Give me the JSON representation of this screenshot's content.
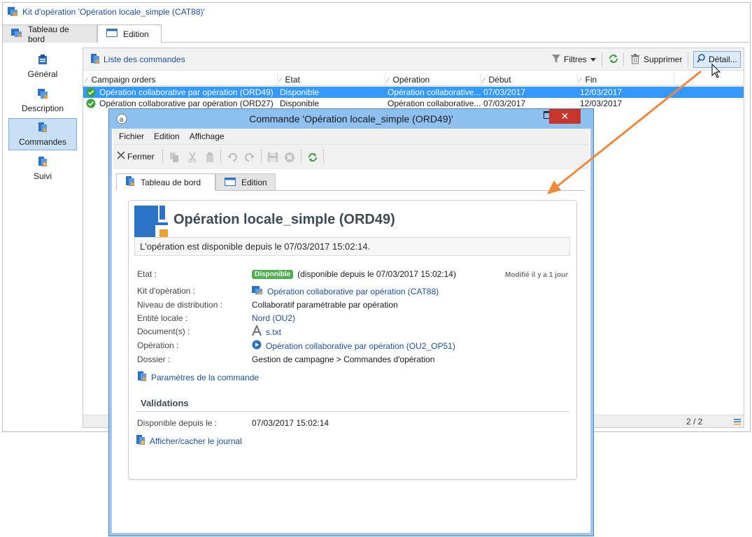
{
  "main": {
    "title": "Kit d'opération 'Opération locale_simple (CAT88)'",
    "tabs": [
      {
        "label": "Tableau de bord"
      },
      {
        "label": "Edition"
      }
    ]
  },
  "nav": {
    "items": [
      {
        "label": "Général"
      },
      {
        "label": "Description"
      },
      {
        "label": "Commandes"
      },
      {
        "label": "Suivi"
      }
    ]
  },
  "list": {
    "title": "Liste des commandes",
    "toolbar": {
      "filters": "Filtres",
      "delete": "Supprimer",
      "detail": "Détail..."
    },
    "columns": [
      "Campaign orders",
      "Etat",
      "Opération",
      "Début",
      "Fin"
    ],
    "rows": [
      {
        "name": "Opération collaborative par opération  (ORD49)",
        "etat": "Disponible",
        "operation": "Opération collaborative...",
        "debut": "07/03/2017",
        "fin": "12/03/2017"
      },
      {
        "name": "Opération collaborative par opération  (ORD27)",
        "etat": "Disponible",
        "operation": "Opération collaborative...",
        "debut": "07/03/2017",
        "fin": "12/03/2017"
      }
    ],
    "pager": "2 / 2"
  },
  "dialog": {
    "title": "Commande 'Opération locale_simple  (ORD49)'",
    "close_glyph": "✕",
    "menu": [
      "Fichier",
      "Edition",
      "Affichage"
    ],
    "close_label": "Fermer",
    "tabs": [
      {
        "label": "Tableau de bord"
      },
      {
        "label": "Edition"
      }
    ],
    "card": {
      "title": "Opération locale_simple (ORD49)",
      "info": "L'opération est disponible depuis le 07/03/2017 15:02:14.",
      "modified": "Modifié il y a 1 jour",
      "props": {
        "etat_label": "Etat :",
        "etat_badge": "Disponible",
        "etat_text": "(disponible depuis le 07/03/2017 15:02:14)",
        "kit_label": "Kit d'opération :",
        "kit_value": "Opération collaborative par opération (CAT88)",
        "niveau_label": "Niveau de distribution :",
        "niveau_value": "Collaboratif paramétrable par opération",
        "entite_label": "Entité locale :",
        "entite_value": "Nord (OU2)",
        "docs_label": "Document(s) :",
        "docs_value": "s.txt",
        "operation_label": "Opération :",
        "operation_value": "Opération collaborative par opération (OU2_OP51)",
        "dossier_label": "Dossier :",
        "dossier_value": "Gestion de campagne > Commandes d'opération"
      },
      "params_link": "Paramètres de la commande",
      "validations_title": "Validations",
      "dispo_label": "Disponible depuis le :",
      "dispo_value": "07/03/2017 15:02:14",
      "journal_link": "Afficher/cacher le journal"
    }
  },
  "colors": {
    "accent": "#3399ff",
    "link": "#1b4f9c",
    "status_green": "#4caf50",
    "close_red": "#c8352b",
    "arrow_orange": "#f08a3a"
  }
}
